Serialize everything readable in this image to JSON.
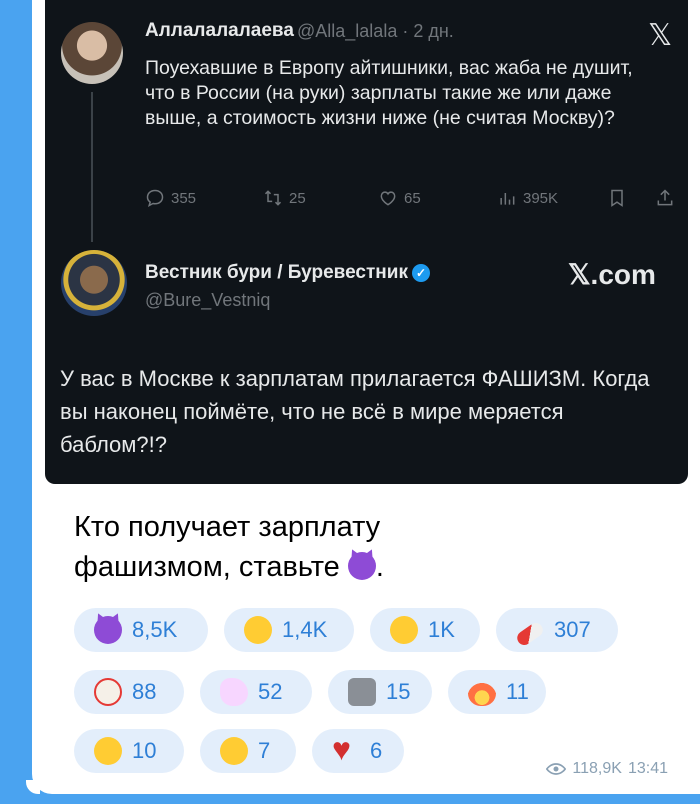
{
  "tweet1": {
    "author_name": "Аллалалалаева",
    "author_handle": "@Alla_lalala",
    "age": "· 2 дн.",
    "x_logo": "𝕏",
    "text": "Поуехавшие в Европу айтишники, вас жаба не душит, что в России (на руки) зарплаты такие же или даже выше, а стоимость жизни ниже (не считая Москву)?",
    "replies": "355",
    "retweets": "25",
    "likes": "65",
    "views": "395K"
  },
  "tweet2": {
    "author_name": "Вестник бури / Буревестник",
    "author_handle": "@Bure_Vestniq",
    "verified_mark": "✓",
    "brand": "𝕏.com",
    "text": "У вас в Москве к зарплатам прилагается ФАШИЗМ. Когда вы наконец поймёте, что не всё в мире меряется баблом?!?"
  },
  "post": {
    "caption_text": "Кто получает зарплату фашизмом, ставьте",
    "caption_end": "."
  },
  "reactions": [
    {
      "icon": "smiling-devil-icon",
      "count": "8,5K"
    },
    {
      "icon": "grinning-face-icon",
      "count": "1,4K"
    },
    {
      "icon": "rofl-face-icon",
      "count": "1K"
    },
    {
      "icon": "pill-icon",
      "count": "307"
    },
    {
      "icon": "clown-face-icon",
      "count": "88"
    },
    {
      "icon": "unicorn-icon",
      "count": "52"
    },
    {
      "icon": "moai-icon",
      "count": "15"
    },
    {
      "icon": "fire-icon",
      "count": "11"
    },
    {
      "icon": "smiling-face-with-hearts-icon",
      "count": "10"
    },
    {
      "icon": "exploding-head-icon",
      "count": "7"
    },
    {
      "icon": "heart-on-fire-icon",
      "count": "6"
    }
  ],
  "meta": {
    "views": "118,9K",
    "time": "13:41"
  },
  "colors": {
    "chat_background": "#4aa3f0",
    "reaction_pill": "#e3eefb",
    "reaction_text": "#2e7fd6",
    "tweet_card": "#0f1419"
  }
}
